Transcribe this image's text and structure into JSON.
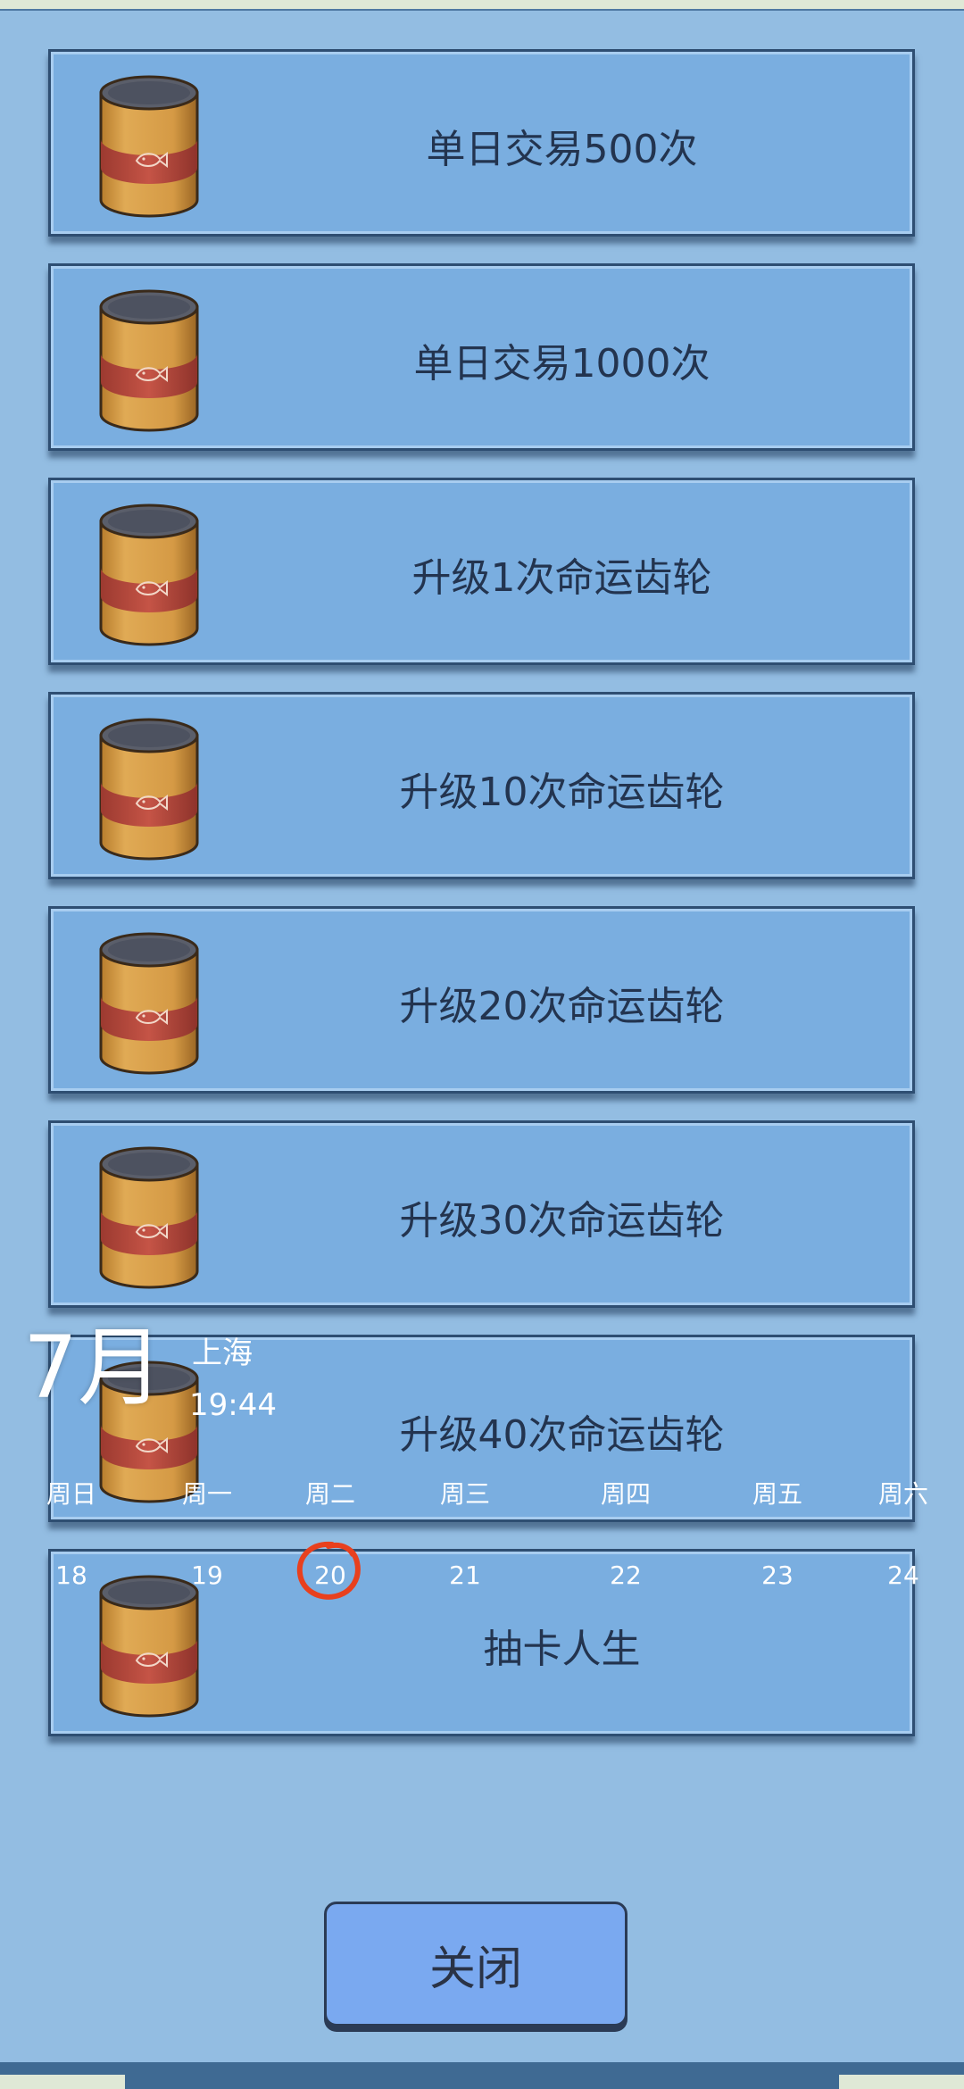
{
  "rewards": [
    {
      "label": "单日交易500次",
      "icon": "fish-can-icon"
    },
    {
      "label": "单日交易1000次",
      "icon": "fish-can-icon"
    },
    {
      "label": "升级1次命运齿轮",
      "icon": "fish-can-icon"
    },
    {
      "label": "升级10次命运齿轮",
      "icon": "fish-can-icon"
    },
    {
      "label": "升级20次命运齿轮",
      "icon": "fish-can-icon"
    },
    {
      "label": "升级30次命运齿轮",
      "icon": "fish-can-icon"
    },
    {
      "label": "升级40次命运齿轮",
      "icon": "fish-can-icon"
    },
    {
      "label": "抽卡人生",
      "icon": "fish-can-icon"
    }
  ],
  "close_label": "关闭",
  "calendar": {
    "month": "7月",
    "city": "上海",
    "time": "19:44",
    "weekdays": [
      "周日",
      "周一",
      "周二",
      "周三",
      "周四",
      "周五",
      "周六"
    ],
    "dates": [
      "18",
      "19",
      "20",
      "21",
      "22",
      "23",
      "24"
    ],
    "today": "20",
    "highlight_color": "#e8401e"
  },
  "colors": {
    "panel": "#93bde2",
    "card": "#7aaee0",
    "close_button": "#7aa9f0",
    "text": "#23344f"
  }
}
